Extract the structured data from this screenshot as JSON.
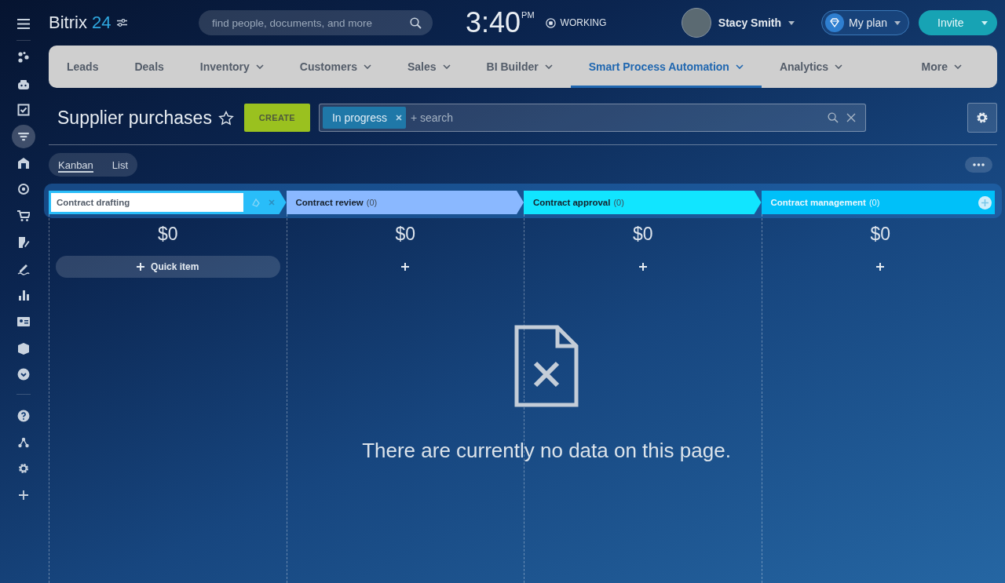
{
  "sidebar": {
    "items": [
      {
        "selected": false
      },
      {
        "selected": false
      },
      {
        "selected": false
      },
      {
        "selected": true
      },
      {
        "selected": false
      },
      {
        "selected": false
      },
      {
        "selected": false
      },
      {
        "selected": false
      },
      {
        "selected": false
      },
      {
        "selected": false
      },
      {
        "selected": false
      },
      {
        "selected": false
      },
      {
        "selected": false
      },
      {
        "selected": false
      },
      {
        "selected": false
      },
      {
        "selected": false
      },
      {
        "selected": false
      }
    ]
  },
  "header": {
    "logo_name": "Bitrix",
    "logo_number": "24",
    "search_placeholder": "find people, documents, and more",
    "time": "3:40",
    "time_suffix": "PM",
    "status": "WORKING",
    "user": "Stacy Smith",
    "plan_button": "My plan",
    "invite_button": "Invite"
  },
  "tabs": [
    {
      "label": "Leads",
      "dropdown": false,
      "selected": false
    },
    {
      "label": "Deals",
      "dropdown": false,
      "selected": false
    },
    {
      "label": "Inventory",
      "dropdown": true,
      "selected": false
    },
    {
      "label": "Customers",
      "dropdown": true,
      "selected": false
    },
    {
      "label": "Sales",
      "dropdown": true,
      "selected": false
    },
    {
      "label": "BI Builder",
      "dropdown": true,
      "selected": false
    },
    {
      "label": "Smart Process Automation",
      "dropdown": true,
      "selected": true
    },
    {
      "label": "Analytics",
      "dropdown": true,
      "selected": false
    },
    {
      "label": "More",
      "dropdown": true,
      "selected": false
    }
  ],
  "page": {
    "title": "Supplier purchases",
    "create_button": "CREATE",
    "filter_chip": "In progress",
    "filter_placeholder": "+ search"
  },
  "views": [
    {
      "label": "Kanban",
      "selected": true
    },
    {
      "label": "List",
      "selected": false
    }
  ],
  "columns": [
    {
      "kind": "editing",
      "title": "Contract drafting",
      "color": "#29bdf9",
      "total": "$0",
      "add_label": "Quick item"
    },
    {
      "kind": "stage",
      "title": "Contract review",
      "count": "(0)",
      "color": "#8ab8ff",
      "total": "$0"
    },
    {
      "kind": "stage",
      "title": "Contract approval",
      "count": "(0)",
      "color": "#11e5ff",
      "total": "$0"
    },
    {
      "kind": "last",
      "title": "Contract management",
      "count": "(0)",
      "color": "#00c0f9",
      "total": "$0"
    }
  ],
  "empty_message": "There are currently no data on this page."
}
